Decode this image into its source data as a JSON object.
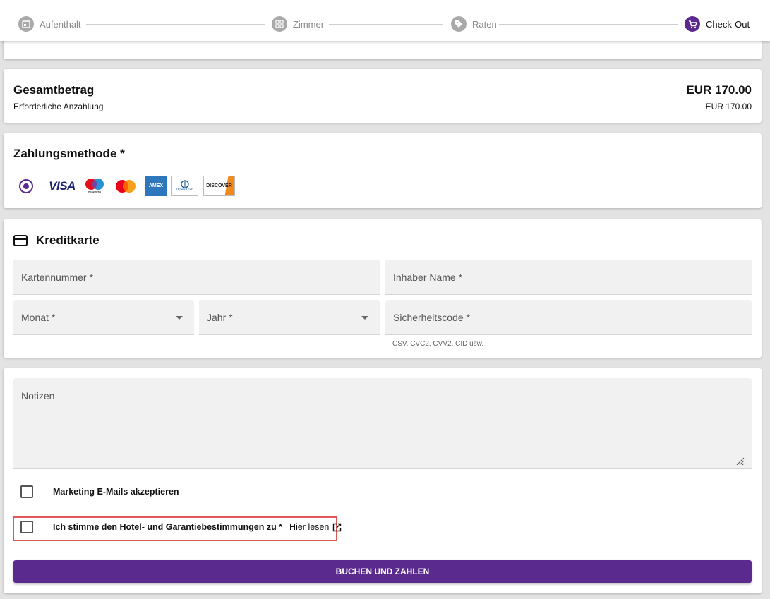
{
  "stepper": {
    "steps": [
      {
        "label": "Aufenthalt",
        "icon": "calendar-icon"
      },
      {
        "label": "Zimmer",
        "icon": "grid-icon"
      },
      {
        "label": "Raten",
        "icon": "tag-icon"
      },
      {
        "label": "Check-Out",
        "icon": "cart-icon"
      }
    ],
    "active": "Check-Out"
  },
  "summary": {
    "title": "Gesamtbetrag",
    "subtitle": "Erforderliche Anzahlung",
    "total": "EUR 170.00",
    "deposit": "EUR 170.00"
  },
  "payment": {
    "title": "Zahlungsmethode *",
    "cards": [
      "VISA",
      "maestro",
      "mastercard",
      "AMEX",
      "Diners Club",
      "DISCOVER"
    ]
  },
  "credit_card": {
    "title": "Kreditkarte",
    "card_number": "Kartennummer *",
    "holder_name": "Inhaber Name *",
    "month": "Monat *",
    "year": "Jahr *",
    "security_code": "Sicherheitscode *",
    "security_hint": "CSV, CVC2, CVV2, CID usw."
  },
  "notes": {
    "placeholder": "Notizen"
  },
  "checks": {
    "marketing": "Marketing E-Mails akzeptieren",
    "terms": "Ich stimme den Hotel- und Garantiebestimmungen zu *",
    "terms_link": "Hier lesen"
  },
  "submit_label": "BUCHEN UND ZAHLEN",
  "colors": {
    "accent": "#5b2a8e",
    "highlight": "#e05555"
  }
}
